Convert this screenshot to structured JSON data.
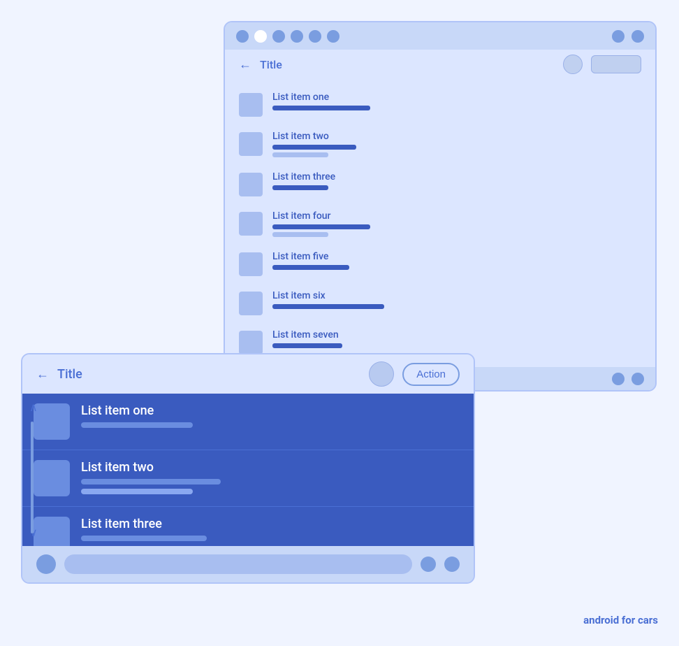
{
  "brand": {
    "label": "android for cars"
  },
  "back_window": {
    "title_bar_dots": [
      "dot",
      "white-dot",
      "dot",
      "dot",
      "dot",
      "dot"
    ],
    "app_bar": {
      "back_label": "←",
      "title": "Title"
    },
    "list_items": [
      {
        "id": 1,
        "title": "List item one",
        "bar1_w": 140,
        "bar2_w": 0
      },
      {
        "id": 2,
        "title": "List item two",
        "bar1_w": 120,
        "bar2_w": 80
      },
      {
        "id": 3,
        "title": "List item three",
        "bar1_w": 80,
        "bar2_w": 0
      },
      {
        "id": 4,
        "title": "List item four",
        "bar1_w": 140,
        "bar2_w": 80
      },
      {
        "id": 5,
        "title": "List item five",
        "bar1_w": 110,
        "bar2_w": 0
      },
      {
        "id": 6,
        "title": "List item six",
        "bar1_w": 160,
        "bar2_w": 0
      },
      {
        "id": 7,
        "title": "List item seven",
        "bar1_w": 100,
        "bar2_w": 0
      }
    ]
  },
  "front_window": {
    "app_bar": {
      "back_label": "←",
      "title": "Title",
      "action_label": "Action"
    },
    "list_items": [
      {
        "id": 1,
        "title": "List item one",
        "bar1_w": 160,
        "bar2_w": 0
      },
      {
        "id": 2,
        "title": "List item two",
        "bar1_w": 200,
        "bar2_w": 160
      },
      {
        "id": 3,
        "title": "List item three",
        "bar1_w": 180,
        "bar2_w": 0
      }
    ]
  }
}
